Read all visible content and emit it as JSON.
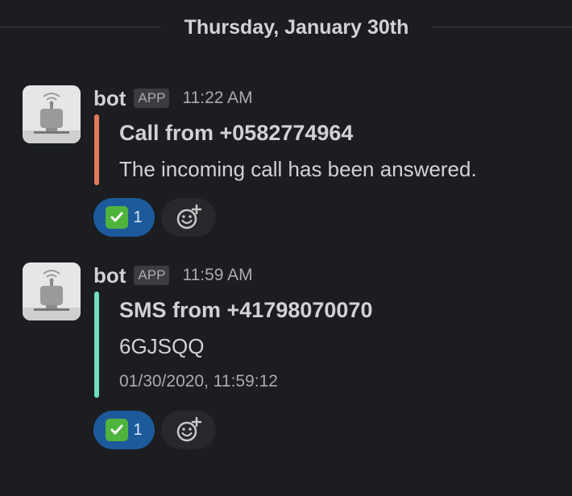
{
  "date_divider": {
    "label": "Thursday, January 30th"
  },
  "colors": {
    "background": "#1b1d21",
    "call_accent": "#e07a5a",
    "sms_accent": "#70dcc0",
    "reaction_bg": "#1d5a9c",
    "check_green": "#4fb43e"
  },
  "messages": [
    {
      "sender": "bot",
      "badge": "APP",
      "time": "11:22 AM",
      "avatar_icon": "robot-icon",
      "attachment": {
        "title": "Call from +0582774964",
        "text": "The incoming call has been answered."
      },
      "reaction": {
        "emoji": "white-check-mark-icon",
        "count": "1"
      }
    },
    {
      "sender": "bot",
      "badge": "APP",
      "time": "11:59 AM",
      "avatar_icon": "robot-icon",
      "attachment": {
        "title": "SMS from +41798070070",
        "text": "6GJSQQ",
        "footer": "01/30/2020, 11:59:12"
      },
      "reaction": {
        "emoji": "white-check-mark-icon",
        "count": "1"
      }
    }
  ]
}
